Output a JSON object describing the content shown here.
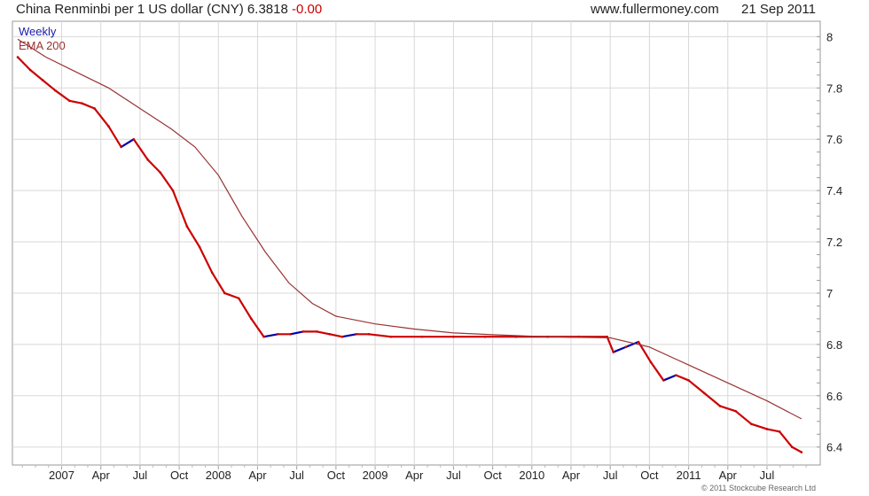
{
  "header": {
    "title": "China Renminbi per 1 US dollar (CNY) 6.3818",
    "change": "-0.00",
    "site": "www.fullermoney.com",
    "date": "21 Sep 2011"
  },
  "footer": {
    "copyright": "© 2011 Stockcube Research Ltd"
  },
  "chart_data": {
    "type": "line",
    "legend": [
      "Weekly",
      "EMA 200"
    ],
    "ylim": [
      6.33,
      8.06
    ],
    "y_ticks": [
      6.4,
      6.6,
      6.8,
      7,
      7.2,
      7.4,
      7.6,
      7.8,
      8
    ],
    "y_tick_labels": [
      "6.4",
      "6.6",
      "6.8",
      "7",
      "7.2",
      "7.4",
      "7.6",
      "7.8",
      "8"
    ],
    "x_range": [
      2006.72,
      2011.8
    ],
    "x_ticks": [
      2007.0,
      2007.25,
      2007.5,
      2007.75,
      2008.0,
      2008.25,
      2008.5,
      2008.75,
      2009.0,
      2009.25,
      2009.5,
      2009.75,
      2010.0,
      2010.25,
      2010.5,
      2010.75,
      2011.0,
      2011.25,
      2011.5
    ],
    "x_tick_labels": [
      "2007",
      "Apr",
      "Jul",
      "Oct",
      "2008",
      "Apr",
      "Jul",
      "Oct",
      "2009",
      "Apr",
      "Jul",
      "Oct",
      "2010",
      "Apr",
      "Jul",
      "Oct",
      "2011",
      "Apr",
      "Jul"
    ],
    "series": [
      {
        "name": "Weekly",
        "color": "#cc0000",
        "up_color": "#0000aa",
        "x": [
          2006.72,
          2006.8,
          2006.88,
          2006.96,
          2007.05,
          2007.13,
          2007.21,
          2007.3,
          2007.38,
          2007.46,
          2007.55,
          2007.63,
          2007.71,
          2007.8,
          2007.88,
          2007.96,
          2008.04,
          2008.13,
          2008.21,
          2008.29,
          2008.38,
          2008.46,
          2008.54,
          2008.63,
          2008.71,
          2008.79,
          2008.88,
          2008.96,
          2009.1,
          2009.3,
          2009.5,
          2009.7,
          2009.9,
          2010.1,
          2010.3,
          2010.48,
          2010.52,
          2010.6,
          2010.68,
          2010.76,
          2010.84,
          2010.92,
          2011.0,
          2011.1,
          2011.2,
          2011.3,
          2011.4,
          2011.5,
          2011.58,
          2011.66,
          2011.72
        ],
        "y": [
          7.92,
          7.87,
          7.83,
          7.79,
          7.75,
          7.74,
          7.72,
          7.65,
          7.57,
          7.6,
          7.52,
          7.47,
          7.4,
          7.26,
          7.18,
          7.08,
          7.0,
          6.98,
          6.9,
          6.83,
          6.84,
          6.84,
          6.85,
          6.85,
          6.84,
          6.83,
          6.84,
          6.84,
          6.83,
          6.83,
          6.83,
          6.83,
          6.83,
          6.83,
          6.83,
          6.83,
          6.77,
          6.79,
          6.81,
          6.73,
          6.66,
          6.68,
          6.66,
          6.61,
          6.56,
          6.54,
          6.49,
          6.47,
          6.46,
          6.4,
          6.38
        ]
      },
      {
        "name": "EMA 200",
        "color": "#993333",
        "x": [
          2006.72,
          2006.9,
          2007.1,
          2007.3,
          2007.5,
          2007.7,
          2007.85,
          2008.0,
          2008.15,
          2008.3,
          2008.45,
          2008.6,
          2008.75,
          2009.0,
          2009.25,
          2009.5,
          2009.75,
          2010.0,
          2010.25,
          2010.5,
          2010.75,
          2011.0,
          2011.25,
          2011.5,
          2011.72
        ],
        "y": [
          7.99,
          7.92,
          7.86,
          7.8,
          7.72,
          7.64,
          7.57,
          7.46,
          7.3,
          7.16,
          7.04,
          6.96,
          6.91,
          6.88,
          6.86,
          6.845,
          6.838,
          6.832,
          6.828,
          6.826,
          6.79,
          6.72,
          6.65,
          6.58,
          6.51
        ]
      }
    ]
  }
}
